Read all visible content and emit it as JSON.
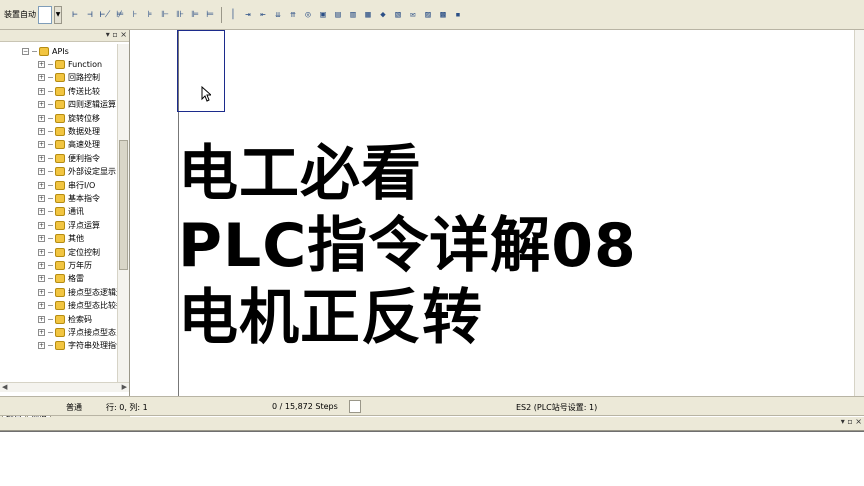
{
  "toolbar": {
    "label": "装置自动",
    "icons": [
      "tool-1-icon",
      "tool-2-icon",
      "tool-3-icon",
      "tool-4-icon",
      "tool-5-icon",
      "tool-6-icon",
      "tool-7-icon",
      "tool-8-icon",
      "tool-9-icon",
      "tool-10-icon",
      "tool-11-icon",
      "tool-12-icon",
      "tool-13-icon",
      "tool-14-icon",
      "tool-15-icon",
      "tool-16-icon",
      "tool-17-icon",
      "tool-18-icon",
      "tool-19-icon",
      "tool-20-icon",
      "tool-21-icon",
      "tool-22-icon",
      "tool-23-icon",
      "tool-24-icon",
      "tool-25-icon",
      "tool-26-icon"
    ]
  },
  "tree": {
    "root": "APIs",
    "items": [
      "Function",
      "回路控制",
      "传送比较",
      "四则逻辑运算",
      "旋转位移",
      "数据处理",
      "高速处理",
      "便利指令",
      "外部设定显示",
      "串行I/O",
      "基本指令",
      "通讯",
      "浮点运算",
      "其他",
      "定位控制",
      "万年历",
      "格雷",
      "接点型态逻辑运",
      "接点型态比较指",
      "检索码",
      "浮点接点型态比",
      "字符串处理指令"
    ]
  },
  "tabs": [
    "项目",
    "通信"
  ],
  "overlay": {
    "line1": "电工必看",
    "line2": "PLC指令详解08",
    "line3": "电机正反转"
  },
  "status": {
    "mode": "普通",
    "position": "行: 0, 列: 1",
    "steps": "0 / 15,872 Steps",
    "plc": "ES2 (PLC站号设置: 1)"
  },
  "pane_buttons": "▾ ▫ ×",
  "colors": {
    "toolbar_bg": "#ece9d8",
    "cursor_border": "#1c2b8c",
    "folder": "#f2c541"
  }
}
